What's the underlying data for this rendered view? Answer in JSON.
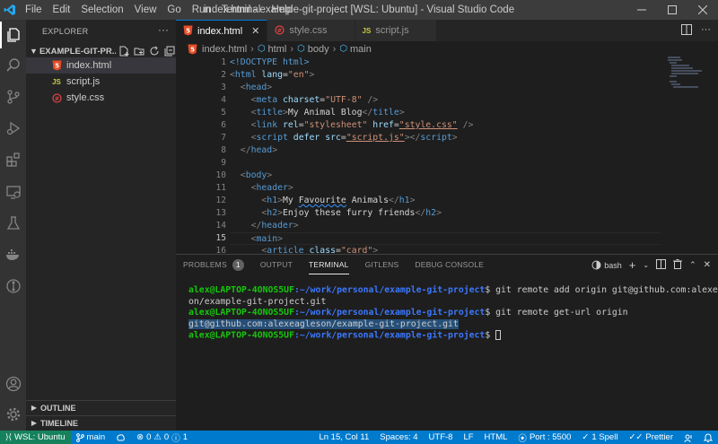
{
  "titlebar": {
    "menu": [
      "File",
      "Edit",
      "Selection",
      "View",
      "Go",
      "Run",
      "Terminal",
      "Help"
    ],
    "title": "index.html - example-git-project [WSL: Ubuntu] - Visual Studio Code"
  },
  "sidebar": {
    "title": "EXPLORER",
    "more": "···",
    "folder": "EXAMPLE-GIT-PR...",
    "files": [
      {
        "name": "index.html",
        "icon": "html-file-icon",
        "glyph": "5",
        "color": "#e44d26"
      },
      {
        "name": "script.js",
        "icon": "js-file-icon",
        "glyph": "JS",
        "color": "#cbcb41"
      },
      {
        "name": "style.css",
        "icon": "css-file-icon",
        "glyph": "#",
        "color": "#e04444"
      }
    ],
    "outline": "OUTLINE",
    "timeline": "TIMELINE"
  },
  "tabs": [
    {
      "label": "index.html",
      "glyph": "5",
      "color": "#e44d26",
      "active": true,
      "close": "✕"
    },
    {
      "label": "style.css",
      "glyph": "#",
      "color": "#e04444",
      "active": false
    },
    {
      "label": "script.js",
      "glyph": "JS",
      "color": "#cbcb41",
      "active": false
    }
  ],
  "breadcrumb": [
    "index.html",
    "html",
    "body",
    "main"
  ],
  "editor": {
    "line_numbers": [
      "1",
      "2",
      "3",
      "4",
      "5",
      "6",
      "7",
      "8",
      "9",
      "10",
      "11",
      "12",
      "13",
      "14",
      "15",
      "16"
    ],
    "current_line": "15",
    "lines": {
      "l1_text": "<!DOCTYPE html>",
      "l2_tag": "html",
      "l2_attr": "lang",
      "l2_val": "\"en\"",
      "l3_tag": "head",
      "l4_tag": "meta",
      "l4_attr": "charset",
      "l4_val": "\"UTF-8\"",
      "l5_tag": "title",
      "l5_text": "My Animal Blog",
      "l6_tag": "link",
      "l6_attr1": "rel",
      "l6_val1": "\"stylesheet\"",
      "l6_attr2": "href",
      "l6_val2": "\"style.css\"",
      "l7_tag": "script",
      "l7_attr1": "defer",
      "l7_attr2": "src",
      "l7_val": "\"script.js\"",
      "l8_tag": "head",
      "l10_tag": "body",
      "l11_tag": "header",
      "l12_tag": "h1",
      "l12_text_a": "My ",
      "l12_text_b": "Favourite",
      "l12_text_c": " Animals",
      "l13_tag": "h2",
      "l13_text": "Enjoy these furry friends",
      "l14_tag": "header",
      "l15_tag": "main",
      "l16_tag": "article",
      "l16_attr": "class",
      "l16_val": "\"card\""
    }
  },
  "panel": {
    "tabs": [
      "PROBLEMS",
      "OUTPUT",
      "TERMINAL",
      "GITLENS",
      "DEBUG CONSOLE"
    ],
    "problems_count": "1",
    "shell": "bash",
    "terminal": {
      "prompt_user": "alex@LAPTOP-4ONOS5UF",
      "prompt_path": ":~/work/personal/example-git-project",
      "cmd1": "$ git remote add origin git@github.com:alexeagles",
      "cmd1_wrap": "on/example-git-project.git",
      "cmd2": "$ git remote get-url origin",
      "output": "git@github.com:alexeagleson/example-git-project.git",
      "cmd3": "$ "
    }
  },
  "statusbar": {
    "remote": "WSL: Ubuntu",
    "branch": "main",
    "errors": "0",
    "warnings": "0",
    "info": "1",
    "position": "Ln 15, Col 11",
    "spaces": "Spaces: 4",
    "encoding": "UTF-8",
    "eol": "LF",
    "language": "HTML",
    "port": "Port : 5500",
    "spell": "1 Spell",
    "prettier": "Prettier"
  },
  "colors": {
    "accent": "#007acc",
    "remote": "#16825d"
  }
}
